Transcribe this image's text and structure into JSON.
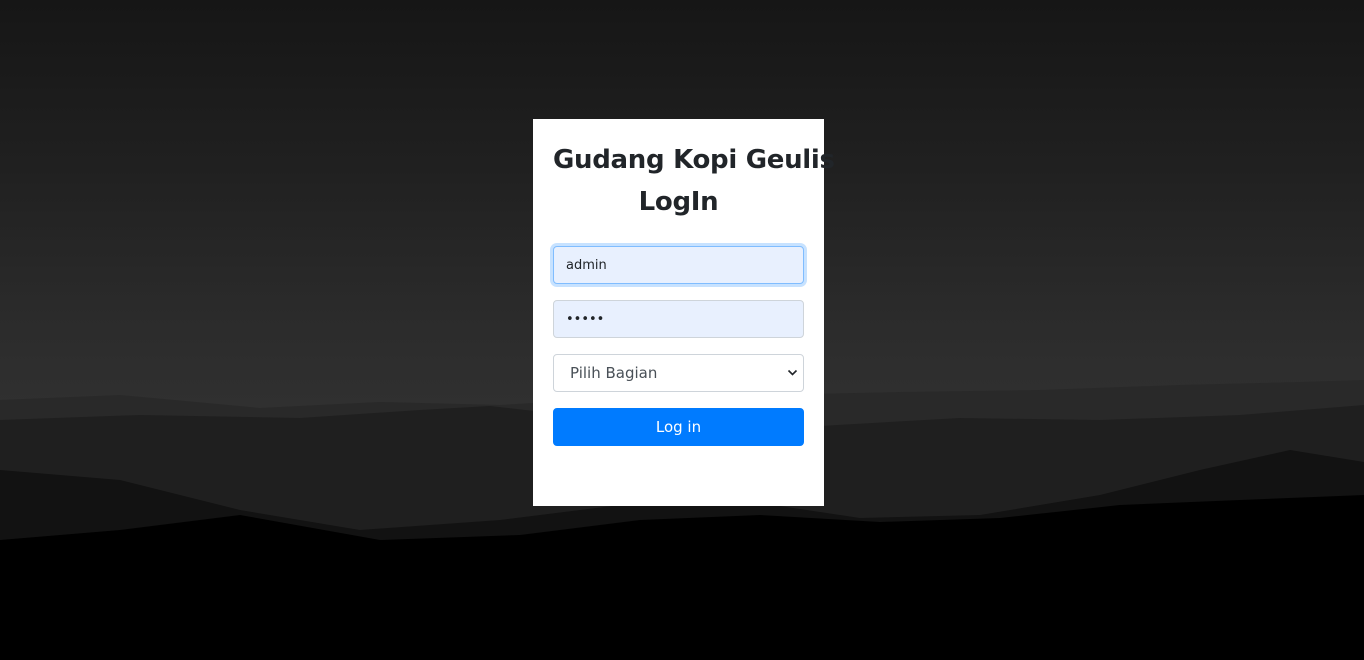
{
  "login": {
    "title_line1": "Gudang Kopi Geulis",
    "title_line2": "LogIn",
    "username": {
      "value": "admin"
    },
    "password": {
      "value": "•••••"
    },
    "role_select": {
      "selected": "Pilih Bagian"
    },
    "submit_label": "Log in"
  },
  "colors": {
    "primary": "#007bff",
    "autofill_bg": "#e8f0fe",
    "card_bg": "#ffffff"
  }
}
